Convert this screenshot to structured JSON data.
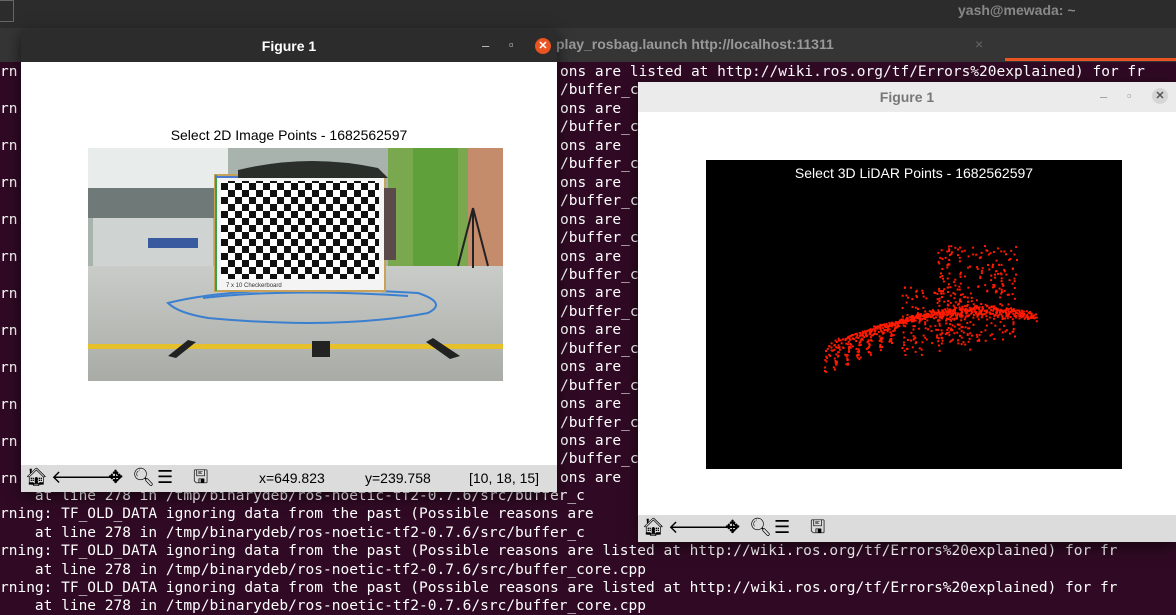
{
  "desktop": {
    "user": "yash@mewada: ~"
  },
  "terminal": {
    "tab_title": "play_rosbag.launch http://localhost:11311",
    "tab_close": "×",
    "lines_left": [
      "rn",
      "rn",
      "rn",
      "rn",
      "rn",
      "rn",
      "rn",
      "rn",
      "rn",
      "rn",
      "rn",
      "rn"
    ],
    "lines_mid": [
      "ons are listed at http://wiki.ros.org/tf/Errors%20explained) for fr",
      "/buffer_c",
      "ons are",
      "/buffer_c",
      "ons are",
      "/buffer_c",
      "ons are",
      "/buffer_c",
      "ons are",
      "/buffer_c",
      "ons are",
      "/buffer_c",
      "ons are",
      "/buffer_c",
      "ons are",
      "/buffer_c",
      "ons are",
      "/buffer_c",
      "ons are",
      "/buffer_c",
      "ons are",
      "/buffer_c",
      "ons are"
    ],
    "bottom": [
      "    at line 278 in /tmp/binarydeb/ros-noetic-tf2-0.7.6/src/buffer_c",
      "rning: TF_OLD_DATA ignoring data from the past (Possible reasons are",
      "    at line 278 in /tmp/binarydeb/ros-noetic-tf2-0.7.6/src/buffer_c",
      "rning: TF_OLD_DATA ignoring data from the past (Possible reasons are listed at http://wiki.ros.org/tf/Errors%20explained) for fr",
      "    at line 278 in /tmp/binarydeb/ros-noetic-tf2-0.7.6/src/buffer_core.cpp",
      "rning: TF_OLD_DATA ignoring data from the past (Possible reasons are listed at http://wiki.ros.org/tf/Errors%20explained) for fr",
      "    at line 278 in /tmp/binarydeb/ros-noetic-tf2-0.7.6/src/buffer_core.cpp"
    ]
  },
  "figure_left": {
    "window_title": "Figure 1",
    "min": "–",
    "max": "▫",
    "close": "✕",
    "plot_title": "Select 2D Image Points - 1682562597",
    "board_caption": "7 x 10 Checkerboard",
    "coords": {
      "x": "x=649.823",
      "y": "y=239.758",
      "pixel": "[10, 18, 15]"
    }
  },
  "figure_right": {
    "window_title": "Figure 1",
    "min": "–",
    "max": "▫",
    "close": "✕",
    "plot_title": "Select 3D LiDAR Points - 1682562597"
  },
  "toolbar_icons": [
    "home-icon",
    "back-arrow-icon",
    "forward-arrow-icon",
    "pan-icon",
    "zoom-icon",
    "configure-subplots-icon",
    "save-icon"
  ],
  "colors": {
    "terminal_bg": "#300a24",
    "close_active": "#e95420",
    "lidar_points": "#ff1a00",
    "tab_accent": "#e95420"
  }
}
